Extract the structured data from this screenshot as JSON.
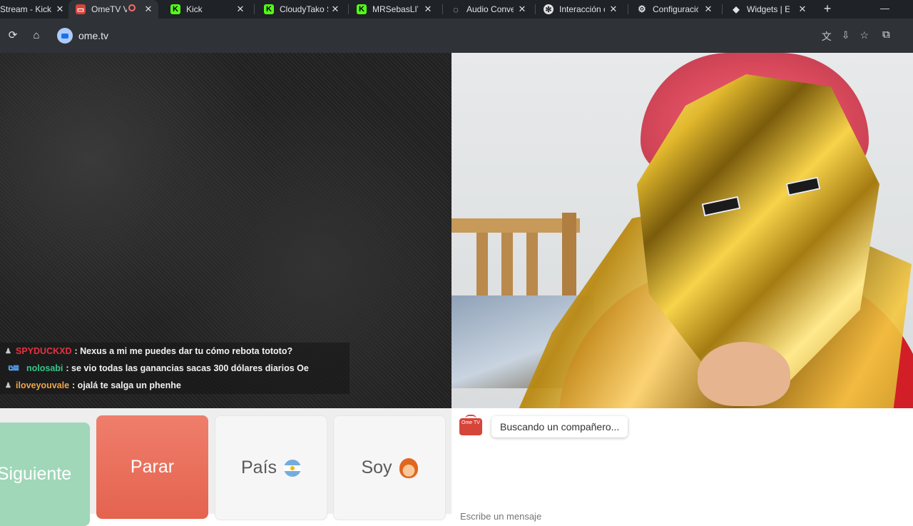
{
  "browser": {
    "tabs": [
      {
        "label": "Stream - Kick",
        "favicon": "none",
        "active": false
      },
      {
        "label": "OmeTV V",
        "favicon": "ometv-icon",
        "active": true,
        "recording": true
      },
      {
        "label": "Kick",
        "favicon": "kick-icon",
        "active": false
      },
      {
        "label": "CloudyTako S",
        "favicon": "kick-icon",
        "active": false
      },
      {
        "label": "MRSebasLIV",
        "favicon": "kick-icon",
        "active": false
      },
      {
        "label": "Audio Conve",
        "favicon": "audio-icon",
        "active": false
      },
      {
        "label": "Interacción c",
        "favicon": "chatgpt-icon",
        "active": false
      },
      {
        "label": "Configuració",
        "favicon": "gear-icon",
        "active": false
      },
      {
        "label": "Widgets | El",
        "favicon": "widget-icon",
        "active": false
      }
    ],
    "url": "ome.tv"
  },
  "stream_chat": [
    {
      "user": "SPYDUCKXD",
      "user_color": "#e8303f",
      "message": ": Nexus a mi me puedes dar tu cómo rebota tototo?"
    },
    {
      "user": "nolosabi",
      "user_color": "#39c48a",
      "message": ": se vio todas las ganancias sacas 300 dólares diarios Oe"
    },
    {
      "user": "iloveyouvale",
      "user_color": "#f0a64b",
      "message": ": ojalá te salga un phenhe"
    }
  ],
  "controls": {
    "next_label": "Siguiente",
    "stop_label": "Parar",
    "country_label": "País",
    "iam_label": "Soy"
  },
  "chat_panel": {
    "logo_text": "Ome TV",
    "status": "Buscando un compañero...",
    "input_placeholder": "Escribe un mensaje"
  },
  "colors": {
    "next": "#9fd7b8",
    "stop": "#e4634f",
    "ometv_red": "#d6453a"
  }
}
